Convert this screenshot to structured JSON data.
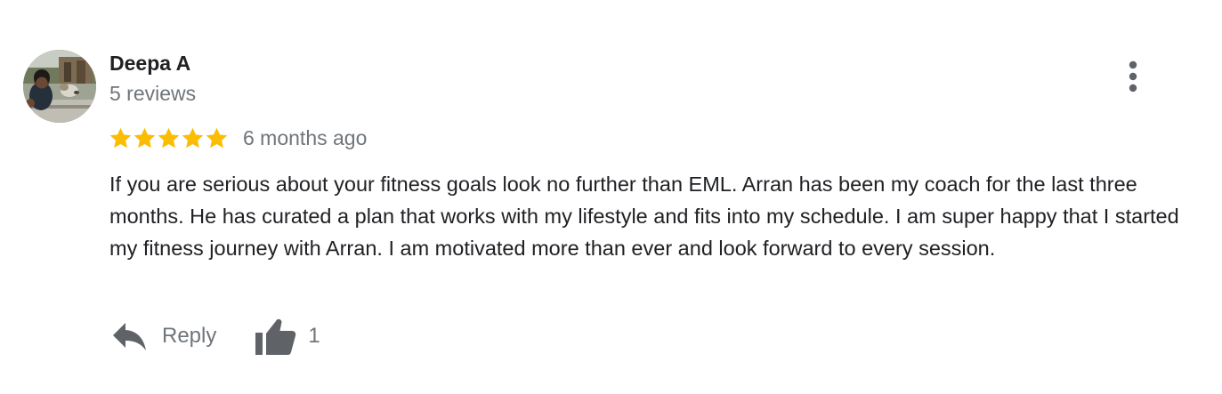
{
  "review": {
    "author_name": "Deepa A",
    "author_review_count": "5 reviews",
    "rating": 5,
    "rating_max": 5,
    "date": "6 months ago",
    "text": "If you are serious about your fitness goals look no further than EML. Arran has been my coach for the last three months. He has curated a plan that works with my lifestyle and fits into my schedule. I am super happy that I started my fitness journey with Arran. I am motivated more than ever and look forward to every session.",
    "actions": {
      "reply_label": "Reply",
      "like_count": "1"
    }
  },
  "icons": {
    "more": "more-vertical-icon",
    "star": "star-icon",
    "reply": "reply-icon",
    "like": "thumbs-up-icon"
  },
  "colors": {
    "star": "#fbbc04",
    "text_primary": "#202124",
    "text_secondary": "#70757a",
    "icon": "#5f6368"
  }
}
